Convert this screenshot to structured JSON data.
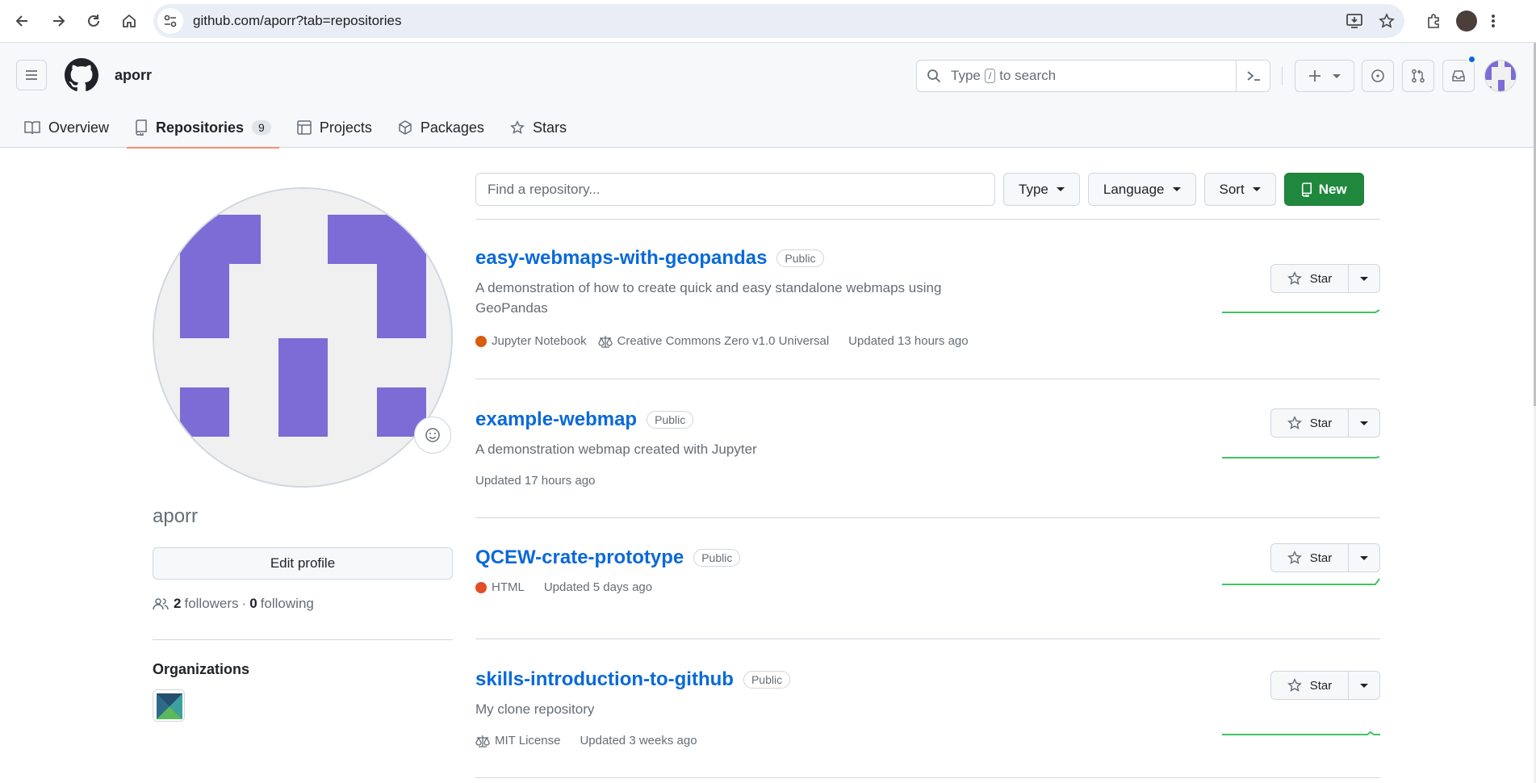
{
  "browser": {
    "url": "github.com/aporr?tab=repositories",
    "icons": [
      "back-icon",
      "forward-icon",
      "reload-icon",
      "home-icon",
      "site-settings-icon",
      "install-app-icon",
      "bookmark-star-icon",
      "extensions-icon",
      "profile-avatar",
      "menu-dots-icon"
    ]
  },
  "header": {
    "username": "aporr",
    "search": {
      "prefix": "Type",
      "key": "/",
      "suffix": "to search"
    }
  },
  "tabs": [
    {
      "label": "Overview",
      "icon": "book-icon"
    },
    {
      "label": "Repositories",
      "icon": "repo-icon",
      "count": "9"
    },
    {
      "label": "Projects",
      "icon": "table-icon"
    },
    {
      "label": "Packages",
      "icon": "package-icon"
    },
    {
      "label": "Stars",
      "icon": "star-icon"
    }
  ],
  "profile": {
    "name": "aporr",
    "edit_label": "Edit profile",
    "followers_count": "2",
    "followers_label": "followers",
    "separator": "·",
    "following_count": "0",
    "following_label": "following",
    "orgs_title": "Organizations"
  },
  "filters": {
    "search_placeholder": "Find a repository...",
    "type_label": "Type",
    "language_label": "Language",
    "sort_label": "Sort",
    "new_label": "New"
  },
  "repos": [
    {
      "name": "easy-webmaps-with-geopandas",
      "visibility": "Public",
      "description": "A demonstration of how to create quick and easy standalone webmaps using GeoPandas",
      "language": "Jupyter Notebook",
      "language_color": "#DA5B0B",
      "license": "Creative Commons Zero v1.0 Universal",
      "updated": "Updated 13 hours ago",
      "star_label": "Star"
    },
    {
      "name": "example-webmap",
      "visibility": "Public",
      "description": "A demonstration webmap created with Jupyter",
      "language": "",
      "license": "",
      "updated": "Updated 17 hours ago",
      "star_label": "Star"
    },
    {
      "name": "QCEW-crate-prototype",
      "visibility": "Public",
      "description": "",
      "language": "HTML",
      "language_color": "#e34c26",
      "license": "",
      "updated": "Updated 5 days ago",
      "star_label": "Star"
    },
    {
      "name": "skills-introduction-to-github",
      "visibility": "Public",
      "description": "My clone repository",
      "language": "",
      "license": "MIT License",
      "updated": "Updated 3 weeks ago",
      "star_label": "Star"
    }
  ],
  "colors": {
    "link": "#0969da",
    "green": "#1f883d",
    "tab_underline": "#fd8c73",
    "identicon": "#7d6bd6",
    "sparkline": "#40c463"
  }
}
